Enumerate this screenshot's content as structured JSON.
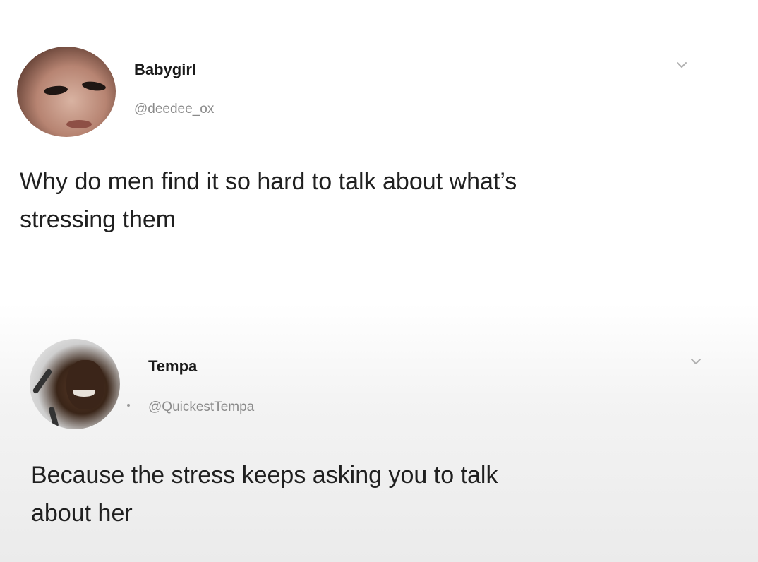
{
  "tweets": [
    {
      "name": "Babygirl",
      "handle": "@deedee_ox",
      "text_line1": "Why do men find it so hard to talk about what’s",
      "text_line2": "stressing them",
      "menu_icon": "chevron-down-icon"
    },
    {
      "name": "Tempa",
      "handle": "@QuickestTempa",
      "text_line1": "Because the stress keeps asking you to talk",
      "text_line2": "about her",
      "menu_icon": "chevron-down-icon"
    }
  ],
  "colors": {
    "name": "#1a1a1a",
    "handle": "#8a8a8a",
    "body_text": "#202020",
    "chevron": "#b0b0b0"
  }
}
